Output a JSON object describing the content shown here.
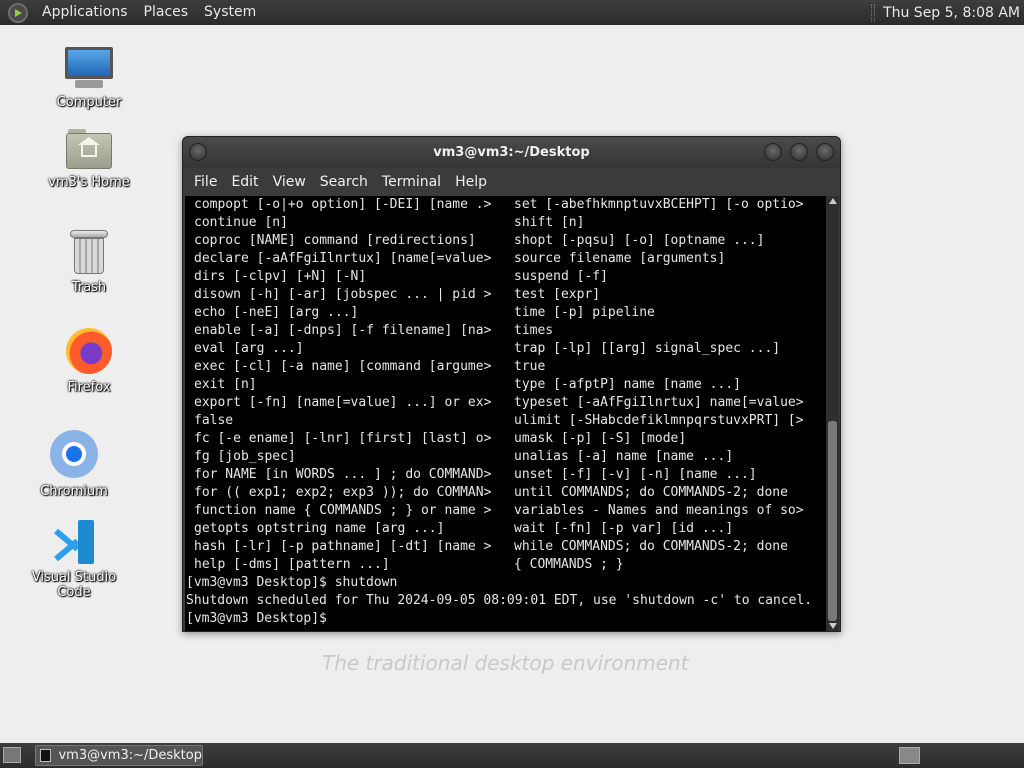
{
  "top_panel": {
    "menus": [
      "Applications",
      "Places",
      "System"
    ],
    "clock": "Thu Sep  5,  8:08 AM"
  },
  "desktop": {
    "icons": [
      {
        "label": "Computer",
        "icon": "computer-icon"
      },
      {
        "label": "vm3's Home",
        "icon": "home-folder-icon"
      },
      {
        "label": "Trash",
        "icon": "trash-icon"
      },
      {
        "label": "Firefox",
        "icon": "firefox-icon"
      },
      {
        "label": "Chromium",
        "icon": "chromium-icon"
      },
      {
        "label": "Visual Studio Code",
        "icon": "vscode-icon"
      }
    ],
    "watermark": "The traditional desktop environment"
  },
  "terminal": {
    "title": "vm3@vm3:~/Desktop",
    "menus": [
      "File",
      "Edit",
      "View",
      "Search",
      "Terminal",
      "Help"
    ],
    "rows": [
      {
        "left": "compopt [-o|+o option] [-DEI] [name .>",
        "right": "set [-abefhkmnptuvxBCEHPT] [-o optio>"
      },
      {
        "left": "continue [n]",
        "right": "shift [n]"
      },
      {
        "left": "coproc [NAME] command [redirections]",
        "right": "shopt [-pqsu] [-o] [optname ...]"
      },
      {
        "left": "declare [-aAfFgiIlnrtux] [name[=value>",
        "right": "source filename [arguments]"
      },
      {
        "left": "dirs [-clpv] [+N] [-N]",
        "right": "suspend [-f]"
      },
      {
        "left": "disown [-h] [-ar] [jobspec ... | pid >",
        "right": "test [expr]"
      },
      {
        "left": "echo [-neE] [arg ...]",
        "right": "time [-p] pipeline"
      },
      {
        "left": "enable [-a] [-dnps] [-f filename] [na>",
        "right": "times"
      },
      {
        "left": "eval [arg ...]",
        "right": "trap [-lp] [[arg] signal_spec ...]"
      },
      {
        "left": "exec [-cl] [-a name] [command [argume>",
        "right": "true"
      },
      {
        "left": "exit [n]",
        "right": "type [-afptP] name [name ...]"
      },
      {
        "left": "export [-fn] [name[=value] ...] or ex>",
        "right": "typeset [-aAfFgiIlnrtux] name[=value>"
      },
      {
        "left": "false",
        "right": "ulimit [-SHabcdefiklmnpqrstuvxPRT] [>"
      },
      {
        "left": "fc [-e ename] [-lnr] [first] [last] o>",
        "right": "umask [-p] [-S] [mode]"
      },
      {
        "left": "fg [job_spec]",
        "right": "unalias [-a] name [name ...]"
      },
      {
        "left": "for NAME [in WORDS ... ] ; do COMMAND>",
        "right": "unset [-f] [-v] [-n] [name ...]"
      },
      {
        "left": "for (( exp1; exp2; exp3 )); do COMMAN>",
        "right": "until COMMANDS; do COMMANDS-2; done"
      },
      {
        "left": "function name { COMMANDS ; } or name >",
        "right": "variables - Names and meanings of so>"
      },
      {
        "left": "getopts optstring name [arg ...]",
        "right": "wait [-fn] [-p var] [id ...]"
      },
      {
        "left": "hash [-lr] [-p pathname] [-dt] [name >",
        "right": "while COMMANDS; do COMMANDS-2; done"
      },
      {
        "left": "help [-dms] [pattern ...]",
        "right": "{ COMMANDS ; }"
      }
    ],
    "prompt_cmd": "[vm3@vm3 Desktop]$ shutdown",
    "output": "Shutdown scheduled for Thu 2024-09-05 08:09:01 EDT, use 'shutdown -c' to cancel.",
    "prompt": "[vm3@vm3 Desktop]$"
  },
  "bottom_panel": {
    "task_label": "vm3@vm3:~/Desktop"
  }
}
